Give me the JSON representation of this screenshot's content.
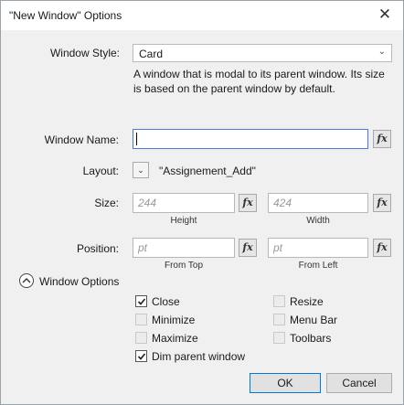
{
  "window": {
    "title": "\"New Window\" Options",
    "close_glyph": "✕"
  },
  "style": {
    "label": "Window Style:",
    "value": "Card",
    "description": "A window that is modal to its parent window. Its size is based on the parent window by default."
  },
  "name": {
    "label": "Window Name:",
    "value": ""
  },
  "layout": {
    "label": "Layout:",
    "value": "\"Assignement_Add\""
  },
  "size": {
    "label": "Size:",
    "height_placeholder": "244",
    "height_caption": "Height",
    "width_placeholder": "424",
    "width_caption": "Width"
  },
  "position": {
    "label": "Position:",
    "top_placeholder": "pt",
    "top_caption": "From Top",
    "left_placeholder": "pt",
    "left_caption": "From Left"
  },
  "fx_label": "fx",
  "options": {
    "header": "Window Options",
    "items": [
      {
        "label": "Close",
        "checked": true,
        "enabled": true
      },
      {
        "label": "Minimize",
        "checked": false,
        "enabled": false
      },
      {
        "label": "Maximize",
        "checked": false,
        "enabled": false
      },
      {
        "label": "Dim parent window",
        "checked": true,
        "enabled": true
      },
      {
        "label": "Resize",
        "checked": false,
        "enabled": false
      },
      {
        "label": "Menu Bar",
        "checked": false,
        "enabled": false
      },
      {
        "label": "Toolbars",
        "checked": false,
        "enabled": false
      }
    ]
  },
  "buttons": {
    "ok": "OK",
    "cancel": "Cancel"
  },
  "colors": {
    "focus_border": "#4a7bd0",
    "ok_border": "#0078d7"
  }
}
